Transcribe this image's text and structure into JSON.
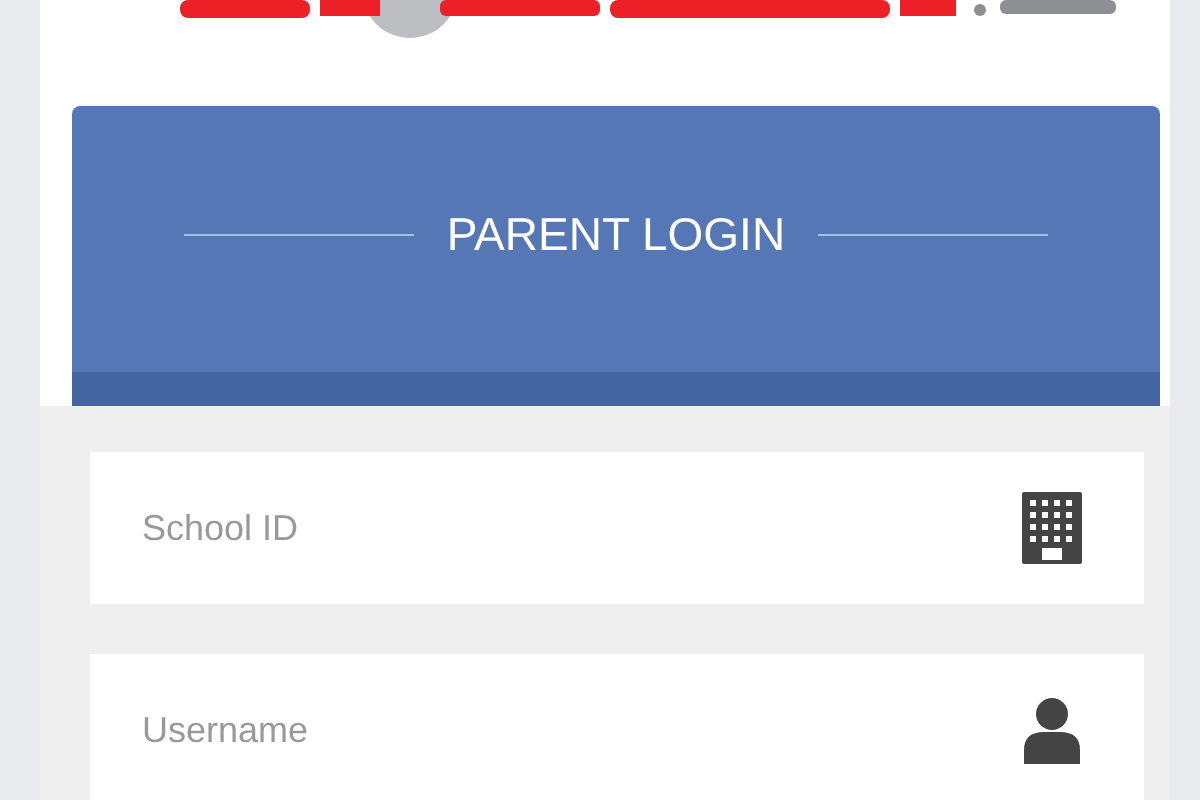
{
  "header": {
    "title": "PARENT LOGIN"
  },
  "fields": [
    {
      "placeholder": "School ID",
      "kind": "building"
    },
    {
      "placeholder": "Username",
      "kind": "user"
    }
  ]
}
